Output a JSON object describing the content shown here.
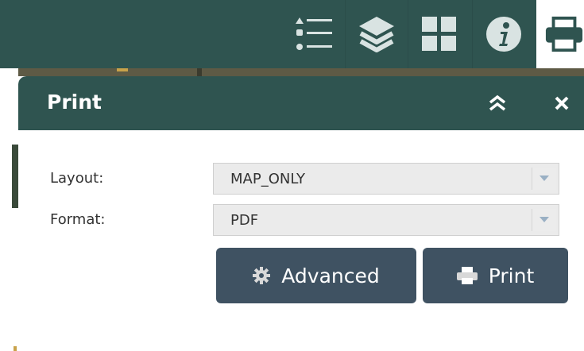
{
  "toolbar": {
    "tools": [
      {
        "name": "legend",
        "icon": "list-icon"
      },
      {
        "name": "layers",
        "icon": "layers-icon"
      },
      {
        "name": "basemap",
        "icon": "grid-icon"
      },
      {
        "name": "about",
        "icon": "info-icon"
      },
      {
        "name": "print",
        "icon": "printer-icon",
        "active": true
      }
    ],
    "color": "#2f5450"
  },
  "panel": {
    "title": "Print",
    "collapse_icon": "double-chevron-up-icon",
    "close_icon": "close-icon",
    "layout_label": "Layout:",
    "layout_value": "MAP_ONLY",
    "format_label": "Format:",
    "format_value": "PDF",
    "advanced_label": "Advanced",
    "print_label": "Print",
    "button_color": "#3f5262"
  }
}
